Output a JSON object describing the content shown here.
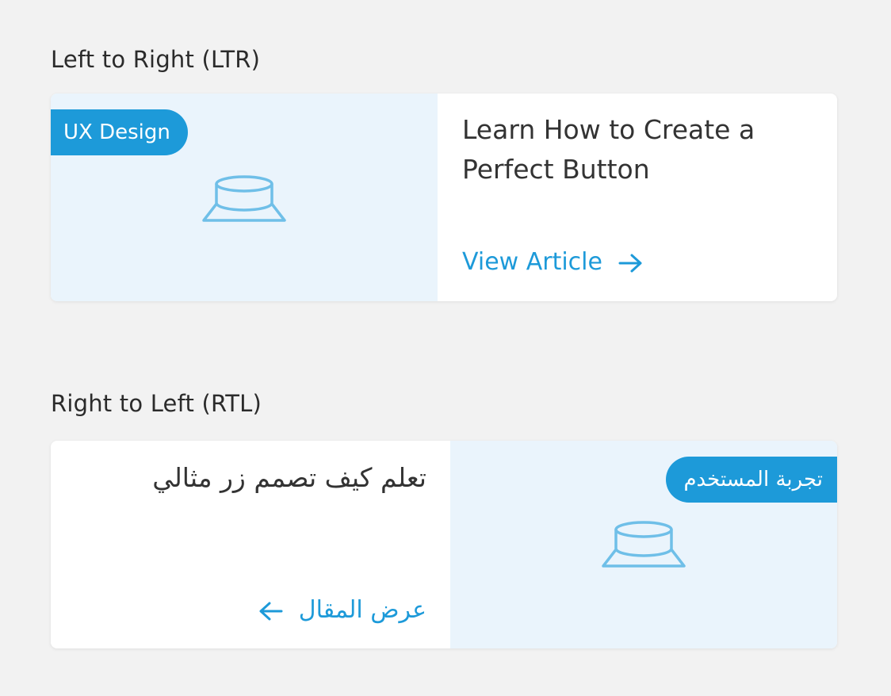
{
  "ltr": {
    "section_title": "Left to Right (LTR)",
    "badge": "UX Design",
    "title": "Learn How to Create a Perfect Button",
    "link": "View Article"
  },
  "rtl": {
    "section_title": "Right to Left (RTL)",
    "badge": "تجربة المستخدم",
    "title": "تعلم كيف تصمم زر مثالي",
    "link": "عرض المقال"
  },
  "icons": {
    "button": "button-illustration-icon",
    "arrow_right": "arrow-right-icon",
    "arrow_left": "arrow-left-icon"
  },
  "colors": {
    "accent": "#1d9ad9",
    "icon_stroke": "#6fbfe8",
    "media_bg": "#eaf4fc",
    "card_bg": "#ffffff",
    "page_bg": "#f2f2f2"
  }
}
